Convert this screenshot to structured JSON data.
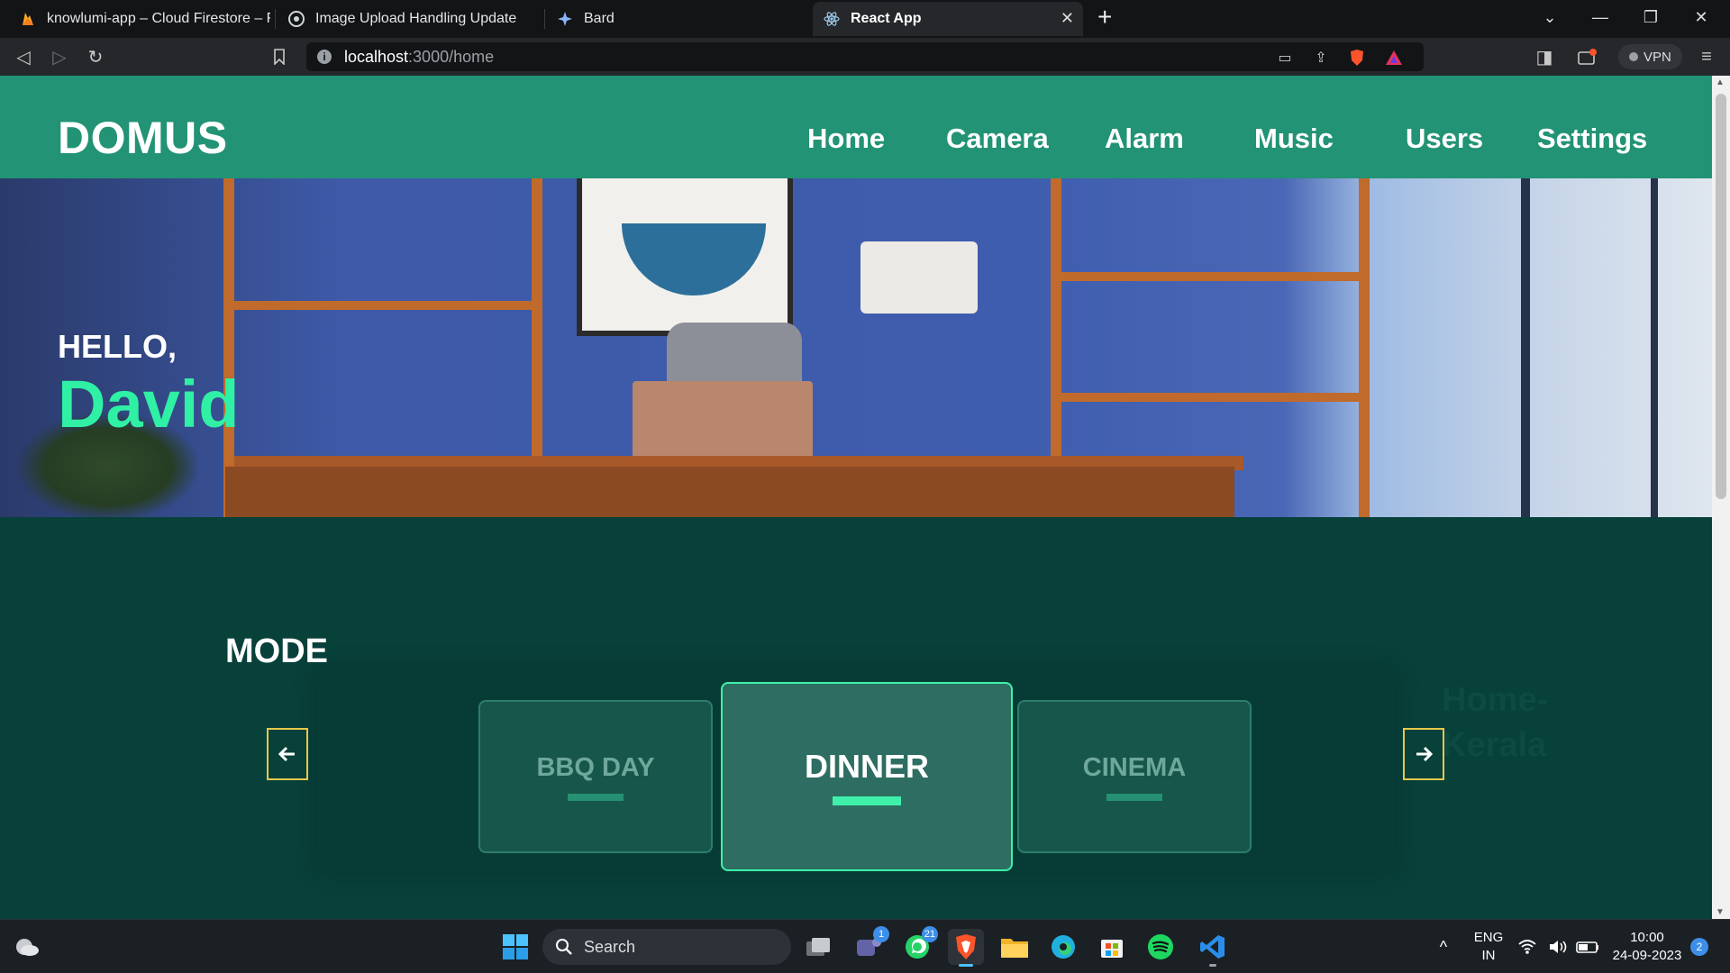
{
  "browser": {
    "tabs": [
      {
        "title": "knowlumi-app – Cloud Firestore – Fire",
        "icon": "firebase-icon"
      },
      {
        "title": "Image Upload Handling Update",
        "icon": "chatgpt-icon"
      },
      {
        "title": "Bard",
        "icon": "bard-icon"
      },
      {
        "title": "React App",
        "icon": "react-icon",
        "active": true
      }
    ],
    "url_host": "localhost",
    "url_path": ":3000/home",
    "vpn_label": "VPN"
  },
  "site": {
    "logo": "DOMUS",
    "nav": [
      "Home",
      "Camera",
      "Alarm",
      "Music",
      "Users",
      "Settings"
    ],
    "greeting": "HELLO,",
    "user_name": "David",
    "mode_title": "MODE",
    "modes": [
      {
        "label": "BBQ DAY"
      },
      {
        "label": "DINNER",
        "active": true
      },
      {
        "label": "CINEMA"
      }
    ],
    "ghost_text_line1": "Home-",
    "ghost_text_line2": "Kerala"
  },
  "taskbar": {
    "search_label": "Search",
    "teams_badge": "1",
    "whatsapp_badge": "21",
    "lang_line1": "ENG",
    "lang_line2": "IN",
    "time": "10:00",
    "date": "24-09-2023",
    "notification_count": "2"
  },
  "colors": {
    "header": "#229375",
    "page_bg": "#08403a",
    "accent": "#2ff0a4"
  }
}
